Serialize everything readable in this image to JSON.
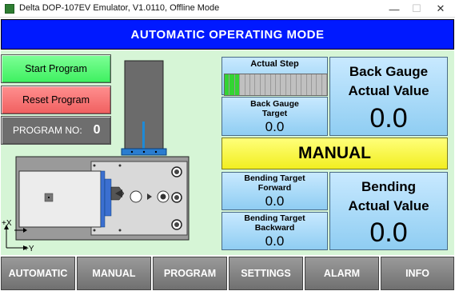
{
  "window": {
    "title": "Delta DOP-107EV Emulator, V1.0110, Offline Mode",
    "minimize_glyph": "—",
    "maximize_glyph": "☐",
    "close_glyph": "✕"
  },
  "header": {
    "title": "AUTOMATIC OPERATING MODE"
  },
  "left_panel": {
    "start_label": "Start Program",
    "reset_label": "Reset Program",
    "program_no_label": "PROGRAM NO:",
    "program_no_value": "0"
  },
  "diagram": {
    "axis_x_label": "+X",
    "axis_y_label": "+Y"
  },
  "actual_step": {
    "label": "Actual Step",
    "total_steps": 20,
    "active_steps": 3
  },
  "back_gauge_target": {
    "title_line1": "Back Gauge",
    "title_line2": "Target",
    "value": "0.0"
  },
  "back_gauge_actual": {
    "title_line1": "Back Gauge",
    "title_line2": "Actual Value",
    "value": "0.0"
  },
  "mode_indicator": {
    "label": "MANUAL"
  },
  "bending_target_forward": {
    "title_line1": "Bending Target",
    "title_line2": "Forward",
    "value": "0.0"
  },
  "bending_target_backward": {
    "title_line1": "Bending Target",
    "title_line2": "Backward",
    "value": "0.0"
  },
  "bending_actual": {
    "title_line1": "Bending",
    "title_line2": "Actual Value",
    "value": "0.0"
  },
  "nav": {
    "automatic": "AUTOMATIC",
    "manual": "MANUAL",
    "program": "PROGRAM",
    "settings": "SETTINGS",
    "alarm": "ALARM",
    "info": "INFO"
  },
  "colors": {
    "header_bg": "#0019ff",
    "content_bg": "#d6f5d6",
    "start_button": "#3ef060",
    "reset_button": "#f06060",
    "mode_indicator": "#f2ee20",
    "panel": "#8fcdf2",
    "nav_button": "#808080"
  }
}
